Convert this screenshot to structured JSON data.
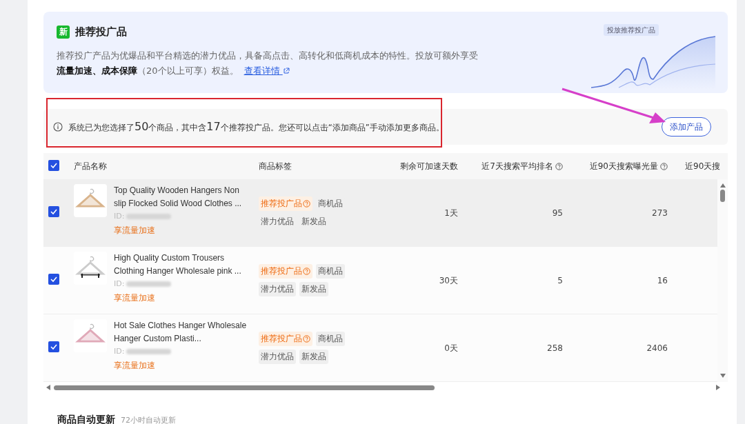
{
  "banner": {
    "badge": "新",
    "title": "推荐投广品",
    "description": "推荐投广产品为优爆品和平台精选的潜力优品，具备高点击、高转化和低商机成本的特性。投放可额外享受",
    "benefits": "流量加速、成本保障",
    "note": "（20个以上可享）权益。",
    "link": "查看详情",
    "illustration_label": "投放推荐投广品"
  },
  "notice": {
    "segments": [
      {
        "kind": "text",
        "text": "系统已为您选择了"
      },
      {
        "kind": "number",
        "text": "50"
      },
      {
        "kind": "text",
        "text": "个商品，其中含"
      },
      {
        "kind": "number",
        "text": "17"
      },
      {
        "kind": "text",
        "text": "个推荐投广品。您还可以点击“添加商品”手动添加更多商品。"
      }
    ],
    "button": "添加产品"
  },
  "table": {
    "all_checked": true,
    "columns": [
      {
        "label": "产品名称",
        "help": false
      },
      {
        "label": "商品标签",
        "help": false
      },
      {
        "label": "剩余可加速天数",
        "help": false
      },
      {
        "label": "近7天搜索平均排名",
        "help": true
      },
      {
        "label": "近90天搜索曝光量",
        "help": true
      },
      {
        "label": "近90天搜",
        "help": false
      }
    ],
    "rows": [
      {
        "checked": true,
        "hovered": true,
        "title": "Top Quality Wooden Hangers Non slip Flocked Solid Wood Clothes ...",
        "id_label": "ID:",
        "perk": "享流量加速",
        "tags": [
          {
            "kind": "recommend",
            "label": "推荐投广品"
          },
          {
            "kind": "plain",
            "label": "商机品"
          },
          {
            "kind": "plain",
            "label": "潜力优品"
          },
          {
            "kind": "plain",
            "label": "新发品"
          }
        ],
        "days": "1天",
        "rank": "95",
        "exposure": "273"
      },
      {
        "checked": true,
        "hovered": false,
        "title": "High Quality Custom Trousers Clothing Hanger Wholesale pink ...",
        "id_label": "ID:",
        "perk": "享流量加速",
        "tags": [
          {
            "kind": "recommend",
            "label": "推荐投广品"
          },
          {
            "kind": "plain",
            "label": "商机品"
          },
          {
            "kind": "plain",
            "label": "潜力优品"
          },
          {
            "kind": "plain",
            "label": "新发品"
          }
        ],
        "days": "30天",
        "rank": "5",
        "exposure": "16"
      },
      {
        "checked": true,
        "hovered": false,
        "title": "Hot Sale Clothes Hanger Wholesale Hanger Custom Plasti...",
        "id_label": "ID:",
        "perk": "享流量加速",
        "tags": [
          {
            "kind": "recommend",
            "label": "推荐投广品"
          },
          {
            "kind": "plain",
            "label": "商机品"
          },
          {
            "kind": "plain",
            "label": "潜力优品"
          },
          {
            "kind": "plain",
            "label": "新发品"
          }
        ],
        "days": "0天",
        "rank": "258",
        "exposure": "2406"
      }
    ]
  },
  "auto_update": {
    "title": "商品自动更新",
    "hint": "72小时自动更新"
  },
  "annotations": [
    {
      "kind": "frame",
      "color": "#d9262e"
    },
    {
      "kind": "arrow",
      "color": "#d63fc9"
    }
  ]
}
